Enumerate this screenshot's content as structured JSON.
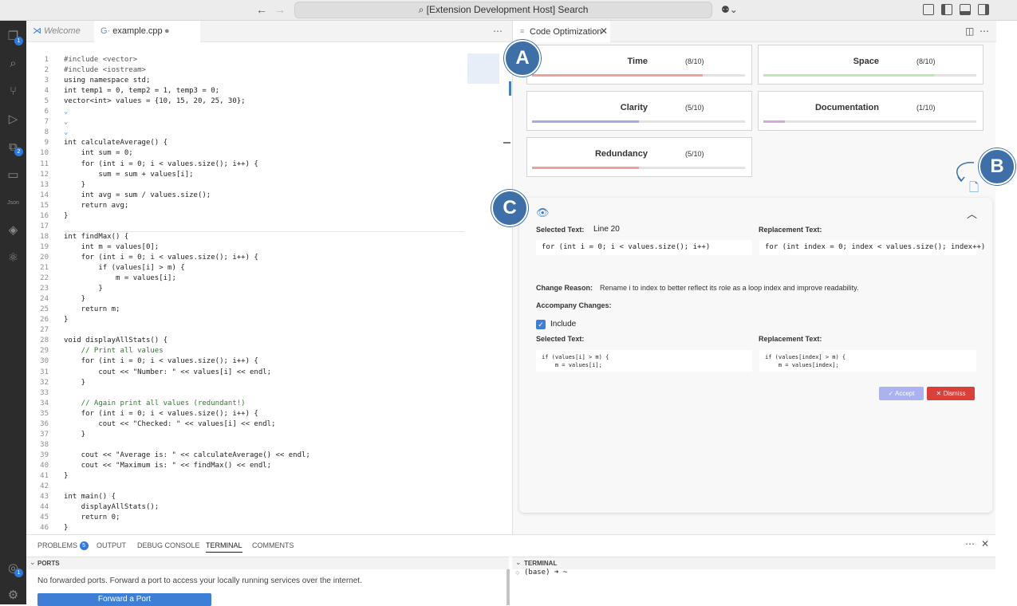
{
  "titlebar": {
    "search_text": "[Extension Development Host] Search"
  },
  "activity_bar": {
    "explorer_badge": "1",
    "extensions_badge": "2",
    "json_icon_text": "Json",
    "account_badge": "1"
  },
  "editor_tabs": [
    {
      "label": "Welcome"
    },
    {
      "label": "example.cpp"
    }
  ],
  "code": {
    "lines": [
      {
        "n": "1",
        "t": "#include <vector>"
      },
      {
        "n": "2",
        "t": "#include <iostream>"
      },
      {
        "n": "3",
        "t": "using namespace std;"
      },
      {
        "n": "4",
        "t": "int temp1 = 0, temp2 = 1, temp3 = 0;"
      },
      {
        "n": "5",
        "t": "vector<int> values = {10, 15, 20, 25, 30};"
      },
      {
        "n": "6",
        "t": "⌄"
      },
      {
        "n": "7",
        "t": "⌄"
      },
      {
        "n": "8",
        "t": "⌄"
      },
      {
        "n": "9",
        "t": "int calculateAverage() {"
      },
      {
        "n": "10",
        "t": "    int sum = 0;"
      },
      {
        "n": "11",
        "t": "    for (int i = 0; i < values.size(); i++) {"
      },
      {
        "n": "12",
        "t": "        sum = sum + values[i];"
      },
      {
        "n": "13",
        "t": "    }"
      },
      {
        "n": "14",
        "t": "    int avg = sum / values.size();"
      },
      {
        "n": "15",
        "t": "    return avg;"
      },
      {
        "n": "16",
        "t": "}"
      },
      {
        "n": "17",
        "t": ""
      },
      {
        "n": "18",
        "t": "int findMax() {"
      },
      {
        "n": "19",
        "t": "    int m = values[0];"
      },
      {
        "n": "20",
        "t": "    for (int i = 0; i < values.size(); i++) {"
      },
      {
        "n": "21",
        "t": "        if (values[i] > m) {"
      },
      {
        "n": "22",
        "t": "            m = values[i];"
      },
      {
        "n": "23",
        "t": "        }"
      },
      {
        "n": "24",
        "t": "    }"
      },
      {
        "n": "25",
        "t": "    return m;"
      },
      {
        "n": "26",
        "t": "}"
      },
      {
        "n": "27",
        "t": ""
      },
      {
        "n": "28",
        "t": "void displayAllStats() {"
      },
      {
        "n": "29",
        "t": "    // Print all values"
      },
      {
        "n": "30",
        "t": "    for (int i = 0; i < values.size(); i++) {"
      },
      {
        "n": "31",
        "t": "        cout << \"Number: \" << values[i] << endl;"
      },
      {
        "n": "32",
        "t": "    }"
      },
      {
        "n": "33",
        "t": ""
      },
      {
        "n": "34",
        "t": "    // Again print all values (redundant!)"
      },
      {
        "n": "35",
        "t": "    for (int i = 0; i < values.size(); i++) {"
      },
      {
        "n": "36",
        "t": "        cout << \"Checked: \" << values[i] << endl;"
      },
      {
        "n": "37",
        "t": "    }"
      },
      {
        "n": "38",
        "t": ""
      },
      {
        "n": "39",
        "t": "    cout << \"Average is: \" << calculateAverage() << endl;"
      },
      {
        "n": "40",
        "t": "    cout << \"Maximum is: \" << findMax() << endl;"
      },
      {
        "n": "41",
        "t": "}"
      },
      {
        "n": "42",
        "t": ""
      },
      {
        "n": "43",
        "t": "int main() {"
      },
      {
        "n": "44",
        "t": "    displayAllStats();"
      },
      {
        "n": "45",
        "t": "    return 0;"
      },
      {
        "n": "46",
        "t": "}"
      }
    ]
  },
  "optimization": {
    "tab_label": "Code Optimization",
    "metrics": [
      {
        "label": "Time",
        "score": "(8/10)",
        "value": 0.8,
        "color": "#e8a49c"
      },
      {
        "label": "Space",
        "score": "(8/10)",
        "value": 0.8,
        "color": "#bde6b0"
      },
      {
        "label": "Clarity",
        "score": "(5/10)",
        "value": 0.5,
        "color": "#a9a9e8"
      },
      {
        "label": "Documentation",
        "score": "(1/10)",
        "value": 0.1,
        "color": "#d9a6dd"
      },
      {
        "label": "Redundancy",
        "score": "(5/10)",
        "value": 0.5,
        "color": "#e8a49c"
      }
    ],
    "suggestion": {
      "selected_label": "Selected Text:",
      "selected_line": "Line 20",
      "replacement_label": "Replacement Text:",
      "selected_code": "for (int i = 0; i < values.size(); i++)",
      "replacement_code": "for (int index = 0; index < values.size(); index++)",
      "reason_label": "Change Reason:",
      "reason": "Rename i to index to better reflect its role as a loop index and improve readability.",
      "accompany_label": "Accompany Changes:",
      "include_label": "Include",
      "acc_selected_label": "Selected Text:",
      "acc_replacement_label": "Replacement Text:",
      "acc_selected_code_1": "if (values[i] > m) {",
      "acc_selected_code_2": "    m = values[i];",
      "acc_replacement_code_1": "if (values[index] > m) {",
      "acc_replacement_code_2": "    m = values[index];",
      "accept_label": "Accept",
      "dismiss_label": "Dismiss"
    }
  },
  "callouts": {
    "a": "A",
    "b": "B",
    "c": "C"
  },
  "panel": {
    "tabs": [
      {
        "label": "PROBLEMS",
        "badge": "5"
      },
      {
        "label": "OUTPUT"
      },
      {
        "label": "DEBUG CONSOLE"
      },
      {
        "label": "TERMINAL"
      },
      {
        "label": "COMMENTS"
      }
    ],
    "ports_header": "PORTS",
    "ports_message": "No forwarded ports. Forward a port to access your locally running services over the internet.",
    "forward_button": "Forward a Port",
    "terminal_header": "TERMINAL",
    "terminal_prompt": "(base) ➜  ~"
  },
  "colors": {
    "accent": "#3d7fd6",
    "callout": "#3f6fa8",
    "dismiss": "#d9403a",
    "accept": "#aab2f0"
  }
}
